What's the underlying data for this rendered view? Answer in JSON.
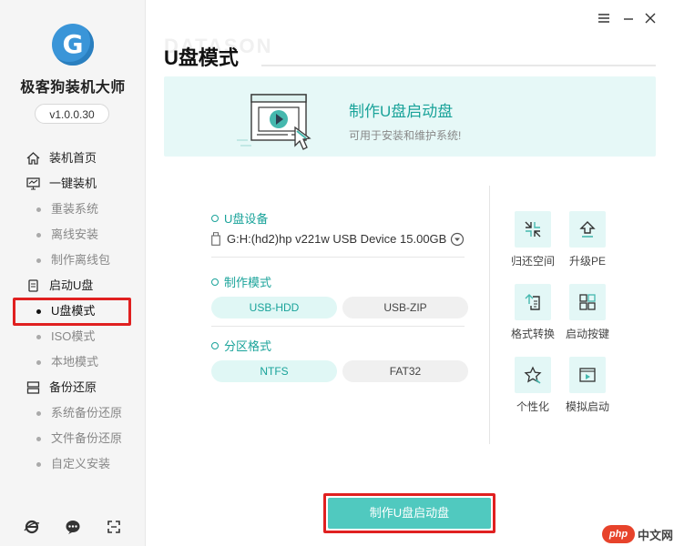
{
  "app": {
    "name": "极客狗装机大师",
    "version": "v1.0.0.30",
    "logo_letter": "G"
  },
  "sidebar": {
    "items": [
      {
        "label": "装机首页",
        "icon": "home-icon"
      },
      {
        "label": "一键装机",
        "icon": "monitor-icon",
        "children": [
          "重装系统",
          "离线安装",
          "制作离线包"
        ]
      },
      {
        "label": "启动U盘",
        "icon": "usb-drive-icon",
        "children": [
          "U盘模式",
          "ISO模式",
          "本地模式"
        ]
      },
      {
        "label": "备份还原",
        "icon": "layers-icon",
        "children": [
          "系统备份还原",
          "文件备份还原",
          "自定义安装"
        ]
      }
    ],
    "active": "U盘模式",
    "bottom_icons": [
      "browser-icon",
      "chat-icon",
      "fullscreen-icon"
    ]
  },
  "window_controls": [
    "menu-icon",
    "minimize-icon",
    "close-icon"
  ],
  "page": {
    "watermark": "DATASON",
    "title": "U盘模式"
  },
  "banner": {
    "title": "制作U盘启动盘",
    "subtitle": "可用于安装和维护系统!"
  },
  "settings": {
    "device_label": "U盘设备",
    "device_value": "G:H:(hd2)hp v221w USB Device 15.00GB",
    "mode_label": "制作模式",
    "modes": [
      "USB-HDD",
      "USB-ZIP"
    ],
    "mode_selected": "USB-HDD",
    "partition_label": "分区格式",
    "partitions": [
      "NTFS",
      "FAT32"
    ],
    "partition_selected": "NTFS"
  },
  "tools": [
    {
      "label": "归还空间",
      "icon": "shrink-icon"
    },
    {
      "label": "升级PE",
      "icon": "upgrade-icon"
    },
    {
      "label": "格式转换",
      "icon": "convert-icon"
    },
    {
      "label": "启动按键",
      "icon": "keyboard-icon"
    },
    {
      "label": "个性化",
      "icon": "star-icon"
    },
    {
      "label": "模拟启动",
      "icon": "play-window-icon"
    }
  ],
  "main_button": "制作U盘启动盘",
  "corner_badge": {
    "brand": "php",
    "text": "中文网"
  },
  "colors": {
    "accent": "#1aa39a",
    "button": "#50c9bf",
    "highlight_border": "#e02020",
    "sidebar_bg": "#f5f5f5",
    "pill_active_bg": "#e0f7f5"
  }
}
